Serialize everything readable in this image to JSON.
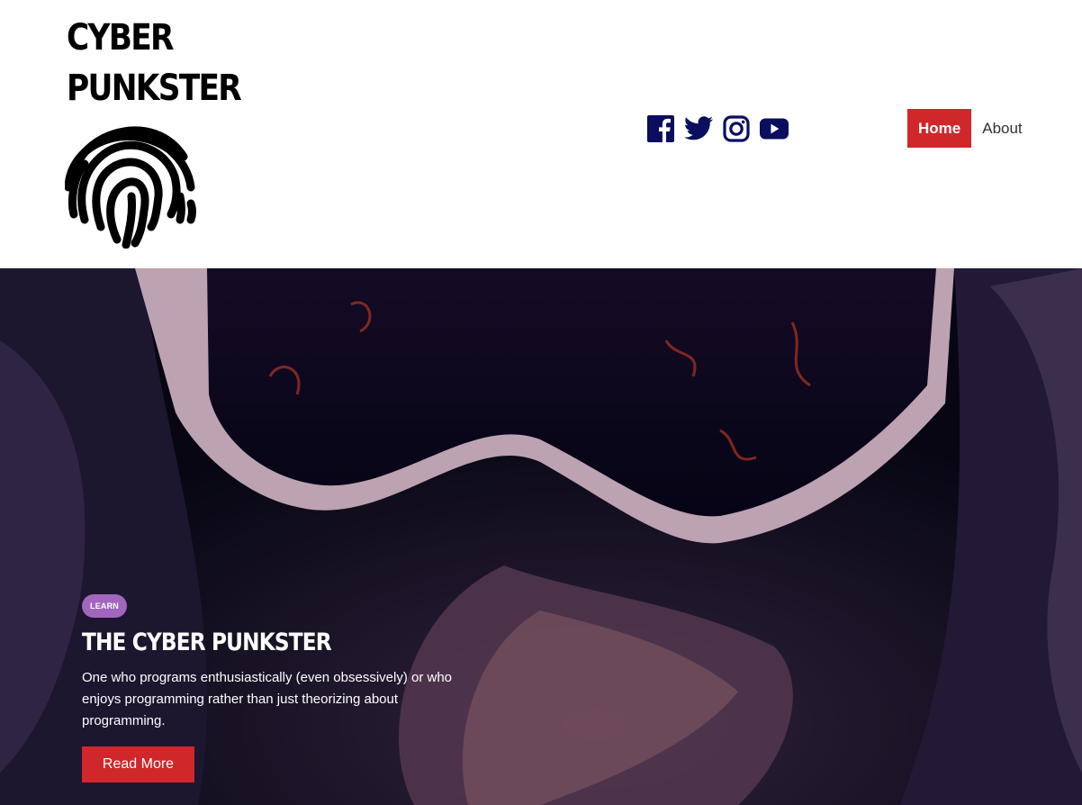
{
  "header": {
    "title_line1": "CYBER",
    "title_line2": "PUNKSTER",
    "logo_icon": "fingerprint-icon"
  },
  "social": {
    "items": [
      {
        "name": "facebook-icon"
      },
      {
        "name": "twitter-icon"
      },
      {
        "name": "instagram-icon"
      },
      {
        "name": "youtube-icon"
      }
    ],
    "color": "#0b0e5e"
  },
  "nav": {
    "items": [
      {
        "label": "Home",
        "active": true
      },
      {
        "label": "About",
        "active": false
      }
    ],
    "accent": "#d0272b"
  },
  "hero": {
    "category": "LEARN",
    "title": "THE CYBER PUNKSTER",
    "excerpt": "One who programs enthusiastically (even obsessively) or who enjoys programming rather than just theorizing about programming.",
    "button_label": "Read More",
    "badge_color": "#a266bd"
  }
}
